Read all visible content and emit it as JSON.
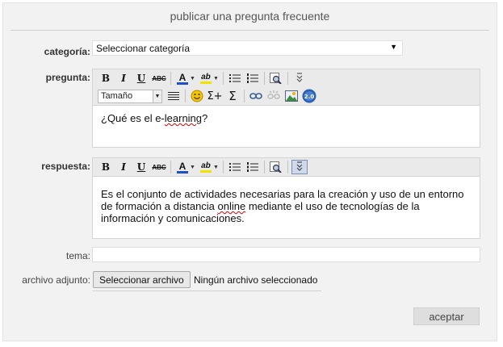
{
  "form": {
    "title": "publicar una pregunta frecuente",
    "category_label": "categoría:",
    "category_value": "Seleccionar categoría",
    "question_label": "pregunta:",
    "question_text": "¿Qué es el e-",
    "question_misspelled": "learning",
    "question_end": "?",
    "answer_label": "respuesta:",
    "answer_text_1": "Es el conjunto de actividades necesarias para la creación y uso de un entorno de formación a distancia ",
    "answer_misspelled": "online",
    "answer_text_2": " mediante el uso de tecnologías de la información y comunicaciones.",
    "topic_label": "tema:",
    "topic_value": "",
    "attachment_label": "archivo adjunto:",
    "file_button": "Seleccionar archivo",
    "file_status": "Ningún archivo seleccionado",
    "submit_label": "aceptar"
  },
  "toolbar": {
    "bold": "B",
    "italic": "I",
    "underline": "U",
    "strike": "ABC",
    "font_color": "A",
    "highlight": "ab",
    "size_label": "Tamaño",
    "sigma": "Σ",
    "sigma_plus": "Σ+"
  },
  "colors": {
    "panel_bg": "#f2f2f2",
    "toolbar_bg": "#eaeaea",
    "font_color_bar": "#1f4fd1",
    "highlight_bar": "#f2e200",
    "smiley": "#f5c400",
    "badge_blue": "#2b5fb3"
  }
}
